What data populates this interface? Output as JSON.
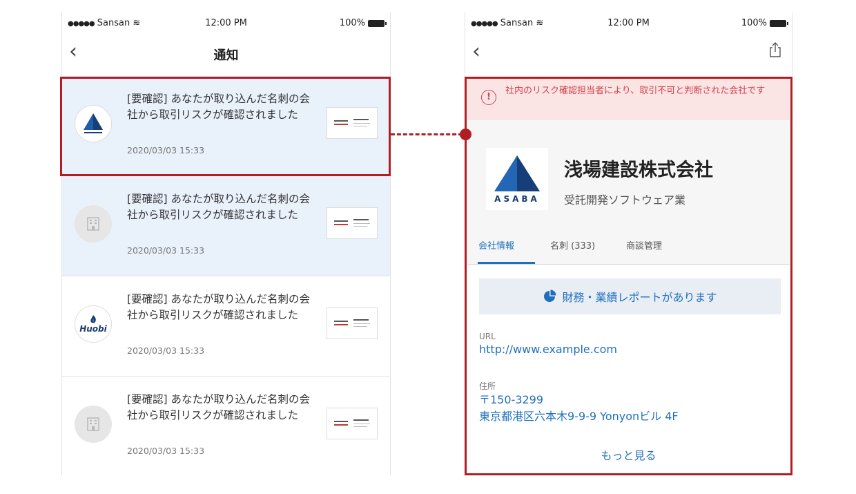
{
  "status_bar": {
    "carrier": "Sansan",
    "time": "12:00 PM",
    "battery": "100%"
  },
  "left_screen": {
    "title": "通知",
    "notifications": [
      {
        "message": "[要確認] あなたが取り込んだ名刺の会社から取引リスクが確認されました",
        "timestamp": "2020/03/03 15:33",
        "avatar": "asaba-logo",
        "unread": true
      },
      {
        "message": "[要確認] あなたが取り込んだ名刺の会社から取引リスクが確認されました",
        "timestamp": "2020/03/03 15:33",
        "avatar": "building-placeholder-icon",
        "unread": true
      },
      {
        "message": "[要確認] あなたが取り込んだ名刺の会社から取引リスクが確認されました",
        "timestamp": "2020/03/03 15:33",
        "avatar": "huobi-logo",
        "avatar_text": "Huobi",
        "unread": false
      },
      {
        "message": "[要確認] あなたが取り込んだ名刺の会社から取引リスクが確認されました",
        "timestamp": "2020/03/03 15:33",
        "avatar": "building-placeholder-icon",
        "unread": false
      }
    ]
  },
  "right_screen": {
    "alert": "社内のリスク確認担当者により、取引不可と判断された会社です",
    "alert_icon": "!",
    "company": {
      "logo_text": "ASABA",
      "name": "浅場建設株式会社",
      "industry": "受託開発ソフトウェア業"
    },
    "tabs": [
      {
        "label": "会社情報",
        "active": true
      },
      {
        "label": "名刺 (333)",
        "active": false
      },
      {
        "label": "商談管理",
        "active": false
      }
    ],
    "report_button": "財務・業績レポートがあります",
    "url_label": "URL",
    "url": "http://www.example.com",
    "address_label": "住所",
    "postal_code": "〒150-3299",
    "address": "東京都港区六本木9-9-9 Yonyonビル 4F",
    "more_link": "もっと見る"
  },
  "colors": {
    "highlight": "#b01d22",
    "accent": "#1f6fbe",
    "alert_bg": "#fbe4e4",
    "alert_text": "#d0424a",
    "unread_bg": "#e9f1fb"
  }
}
